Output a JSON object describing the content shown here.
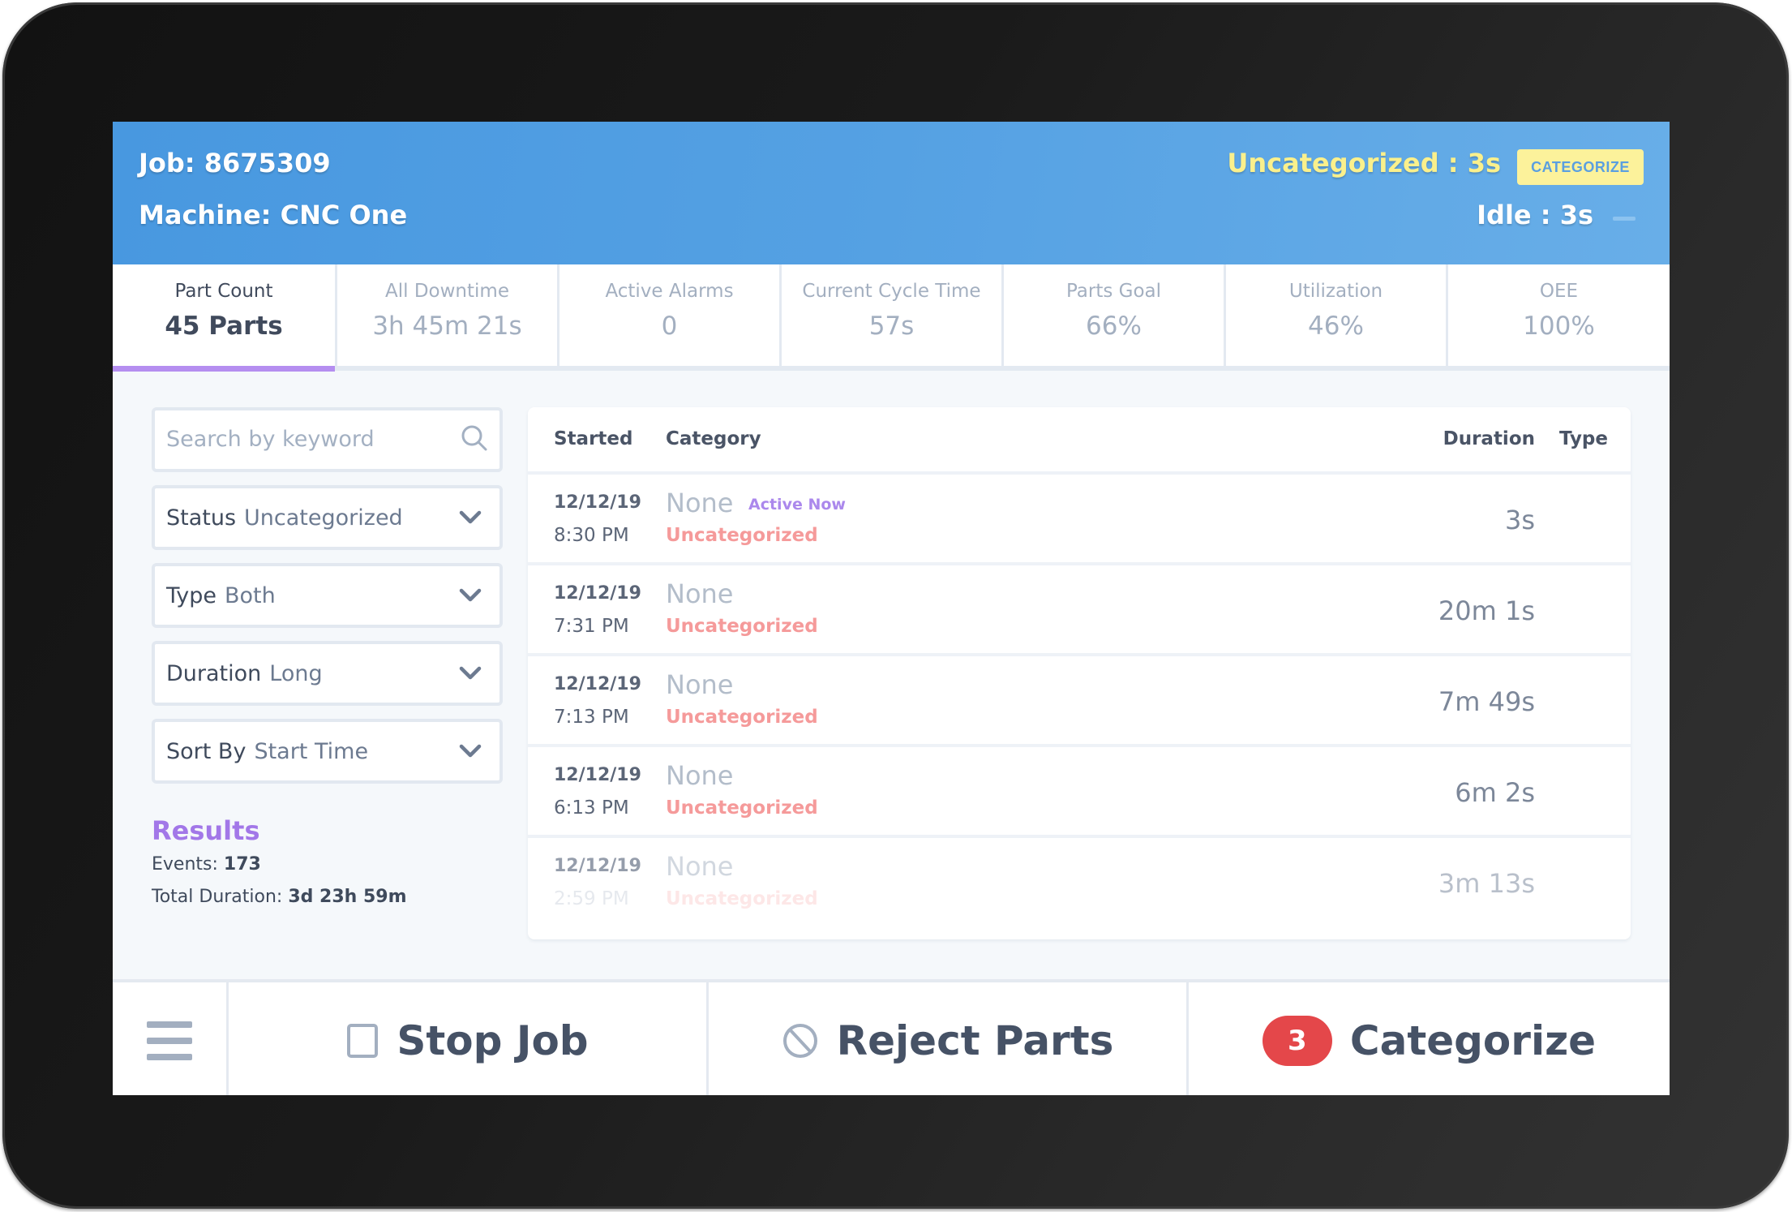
{
  "header": {
    "job": "Job: 8675309",
    "machine": "Machine: CNC One",
    "uncategorized": "Uncategorized : 3s",
    "categorize_button": "CATEGORIZE",
    "idle": "Idle : 3s"
  },
  "stats": [
    {
      "label": "Part Count",
      "value": "45 Parts",
      "active": true
    },
    {
      "label": "All Downtime",
      "value": "3h 45m 21s"
    },
    {
      "label": "Active Alarms",
      "value": "0"
    },
    {
      "label": "Current Cycle Time",
      "value": "57s"
    },
    {
      "label": "Parts Goal",
      "value": "66%"
    },
    {
      "label": "Utilization",
      "value": "46%"
    },
    {
      "label": "OEE",
      "value": "100%"
    }
  ],
  "filters": {
    "search_placeholder": "Search by keyword",
    "status": {
      "label": "Status",
      "value": "Uncategorized"
    },
    "type": {
      "label": "Type",
      "value": "Both"
    },
    "duration": {
      "label": "Duration",
      "value": "Long"
    },
    "sort": {
      "label": "Sort By",
      "value": "Start Time"
    }
  },
  "results": {
    "title": "Results",
    "events_label": "Events:",
    "events_value": "173",
    "total_label": "Total Duration:",
    "total_value": "3d 23h 59m"
  },
  "table": {
    "columns": [
      "Started",
      "Category",
      "Duration",
      "Type"
    ],
    "rows": [
      {
        "date": "12/12/19",
        "time": "8:30 PM",
        "category": "None",
        "badge": "Active Now",
        "status": "Uncategorized",
        "duration": "3s"
      },
      {
        "date": "12/12/19",
        "time": "7:31 PM",
        "category": "None",
        "status": "Uncategorized",
        "duration": "20m 1s"
      },
      {
        "date": "12/12/19",
        "time": "7:13 PM",
        "category": "None",
        "status": "Uncategorized",
        "duration": "7m 49s"
      },
      {
        "date": "12/12/19",
        "time": "6:13 PM",
        "category": "None",
        "status": "Uncategorized",
        "duration": "6m 2s"
      },
      {
        "date": "12/12/19",
        "time": "2:59 PM",
        "category": "None",
        "status": "Uncategorized",
        "duration": "3m 13s"
      }
    ]
  },
  "bottom_bar": {
    "menu_icon": "hamburger-menu-icon",
    "stop_job": "Stop Job",
    "reject_parts": "Reject Parts",
    "categorize": "Categorize",
    "categorize_count": "3"
  },
  "colors": {
    "header_blue": "#4898e0",
    "accent_purple": "#b58ef0",
    "uncategorized_yellow": "#faf08c",
    "status_red": "#f59a9a",
    "badge_red": "#e4474a"
  }
}
